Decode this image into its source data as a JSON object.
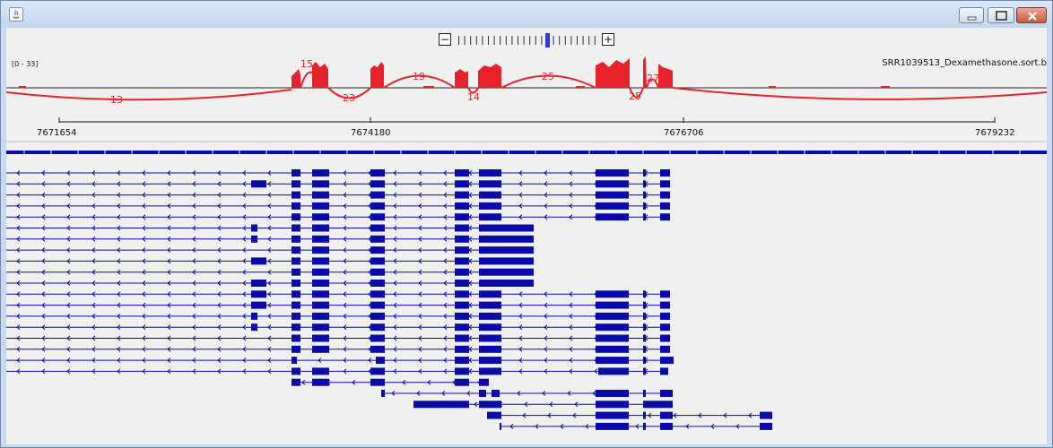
{
  "window": {
    "title": "",
    "controls": [
      "minimize-icon",
      "maximize-icon",
      "close-icon"
    ]
  },
  "zoom": {
    "minus_label": "−",
    "plus_label": "+",
    "tick_count": 24,
    "current_level": 15
  },
  "track": {
    "range_label": "[0 - 33]",
    "name": "SRR1039513_Dexamethasone.sort.b",
    "coverage_color": "#e8222a",
    "junction_color": "#e8222a"
  },
  "junctions": [
    {
      "label": "15",
      "side": "above"
    },
    {
      "label": "19",
      "side": "above"
    },
    {
      "label": "25",
      "side": "above"
    },
    {
      "label": "27",
      "side": "above"
    },
    {
      "label": "13",
      "side": "below"
    },
    {
      "label": "23",
      "side": "below"
    },
    {
      "label": "14",
      "side": "below"
    },
    {
      "label": "25",
      "side": "below"
    }
  ],
  "ruler": {
    "labels": [
      "7671654",
      "7674180",
      "7676706",
      "7679232"
    ]
  },
  "features": {
    "color": "#0a0aa8",
    "transcript_count": 28
  }
}
